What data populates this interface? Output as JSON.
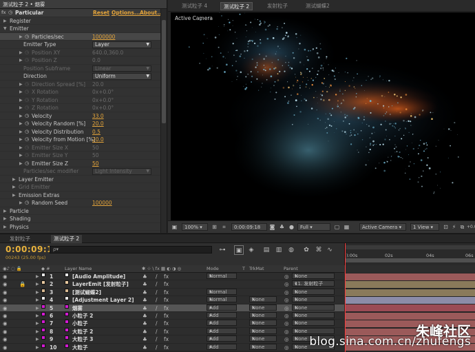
{
  "effect_controls": {
    "tab_title": "测试粒子 2 • 烟雾",
    "effect_name": "Particular",
    "reset_label": "Reset",
    "options_label": "Options...",
    "about_label": "About...",
    "rows": [
      {
        "label": "Register",
        "kind": "group",
        "indent": 1,
        "open": false
      },
      {
        "label": "Emitter",
        "kind": "group",
        "indent": 1,
        "open": true
      },
      {
        "label": "Particles/sec",
        "kind": "value",
        "indent": 2,
        "value": "1000000",
        "selected": true
      },
      {
        "label": "Emitter Type",
        "kind": "dropdown",
        "indent": 2,
        "value": "Layer"
      },
      {
        "label": "Position XY",
        "kind": "value",
        "indent": 2,
        "value": "640.0,360.0",
        "dim": true
      },
      {
        "label": "Position Z",
        "kind": "value",
        "indent": 2,
        "value": "0.0",
        "dim": true
      },
      {
        "label": "Position Subframe",
        "kind": "dropdown",
        "indent": 2,
        "value": "Linear",
        "dim": true
      },
      {
        "label": "Direction",
        "kind": "dropdown",
        "indent": 2,
        "value": "Uniform"
      },
      {
        "label": "Direction Spread [%]",
        "kind": "value",
        "indent": 2,
        "value": "20.0",
        "dim": true
      },
      {
        "label": "X Rotation",
        "kind": "value",
        "indent": 2,
        "value": "0x+0.0°",
        "dim": true
      },
      {
        "label": "Y Rotation",
        "kind": "value",
        "indent": 2,
        "value": "0x+0.0°",
        "dim": true
      },
      {
        "label": "Z Rotation",
        "kind": "value",
        "indent": 2,
        "value": "0x+0.0°",
        "dim": true
      },
      {
        "label": "Velocity",
        "kind": "value",
        "indent": 2,
        "value": "33.0"
      },
      {
        "label": "Velocity Random [%]",
        "kind": "value",
        "indent": 2,
        "value": "20.0"
      },
      {
        "label": "Velocity Distribution",
        "kind": "value",
        "indent": 2,
        "value": "0.5"
      },
      {
        "label": "Velocity from Motion [%]",
        "kind": "value",
        "indent": 2,
        "value": "20.0"
      },
      {
        "label": "Emitter Size X",
        "kind": "value",
        "indent": 2,
        "value": "50",
        "dim": true
      },
      {
        "label": "Emitter Size Y",
        "kind": "value",
        "indent": 2,
        "value": "50",
        "dim": true
      },
      {
        "label": "Emitter Size Z",
        "kind": "value",
        "indent": 2,
        "value": "50"
      },
      {
        "label": "Particles/sec modifier",
        "kind": "dropdown",
        "indent": 2,
        "value": "Light Intensity",
        "dim": true
      },
      {
        "label": "Layer Emitter",
        "kind": "group",
        "indent": 2,
        "open": false
      },
      {
        "label": "Grid Emitter",
        "kind": "group",
        "indent": 2,
        "open": false,
        "dim": true
      },
      {
        "label": "Emission Extras",
        "kind": "group",
        "indent": 2,
        "open": false
      },
      {
        "label": "Random Seed",
        "kind": "value",
        "indent": 2,
        "value": "100000"
      },
      {
        "label": "Particle",
        "kind": "group",
        "indent": 1,
        "open": false
      },
      {
        "label": "Shading",
        "kind": "group",
        "indent": 1,
        "open": false
      },
      {
        "label": "Physics",
        "kind": "group",
        "indent": 1,
        "open": false
      }
    ]
  },
  "composition": {
    "tabs": [
      "测试粒子 4",
      "测试粒子 2",
      "发射粒子",
      "测试蝴蝶2"
    ],
    "active_tab": 1,
    "viewer_label": "Active Camera",
    "toolbar": {
      "zoom": "100%",
      "timecode": "0:00:09:18",
      "resolution": "Full",
      "camera": "Active Camera",
      "view": "1 View",
      "exposure": "+0.0"
    }
  },
  "timeline": {
    "tabs": [
      "发射粒子",
      "测试粒子 2"
    ],
    "active_tab": 1,
    "timecode": "0:00:09:18",
    "frame_info": "00243 (25.00 fps)",
    "search_placeholder": "ρ▾",
    "columns": {
      "layer_name": "Layer Name",
      "mode": "Mode",
      "t": "T",
      "trkmat": "TrkMat",
      "parent": "Parent"
    },
    "ruler_ticks": [
      "):00s",
      "02s",
      "04s",
      "06s"
    ],
    "layers": [
      {
        "num": "1",
        "name": "[Audio Amplitude]",
        "label_color": "#e8e8e8",
        "mode": "Normal",
        "trkmat": "",
        "parent": "None",
        "bar_color": "#9b5a5a"
      },
      {
        "num": "2",
        "name": "LayerEmit [发射粒子]",
        "label_color": "#e8c9a0",
        "mode": "",
        "trkmat": "",
        "parent": "11. 发射粒子",
        "bar_color": "#8a7a5a"
      },
      {
        "num": "3",
        "name": "[测试蝴蝶2]",
        "label_color": "#d8b890",
        "mode": "Normal",
        "trkmat": "",
        "parent": "None",
        "bar_color": "#8a7a5a"
      },
      {
        "num": "4",
        "name": "[Adjustment Layer 2]",
        "label_color": "#e8e8e8",
        "mode": "Normal",
        "trkmat": "None",
        "parent": "None",
        "bar_color": "#8c8ca8"
      },
      {
        "num": "5",
        "name": "烟雾",
        "label_color": "#d21ad2",
        "mode": "Add",
        "trkmat": "None",
        "parent": "None",
        "bar_color": "#9b4b55",
        "selected": true
      },
      {
        "num": "6",
        "name": "小粒子 2",
        "label_color": "#d21ad2",
        "mode": "Add",
        "trkmat": "None",
        "parent": "None",
        "bar_color": "#9b5a5a"
      },
      {
        "num": "7",
        "name": "小粒子",
        "label_color": "#d21ad2",
        "mode": "Add",
        "trkmat": "None",
        "parent": "None",
        "bar_color": "#9b5a5a"
      },
      {
        "num": "8",
        "name": "大粒子 2",
        "label_color": "#d21ad2",
        "mode": "Add",
        "trkmat": "None",
        "parent": "None",
        "bar_color": "#9b5a5a"
      },
      {
        "num": "9",
        "name": "大粒子 3",
        "label_color": "#d21ad2",
        "mode": "Add",
        "trkmat": "None",
        "parent": "None",
        "bar_color": "#9b5a5a"
      },
      {
        "num": "10",
        "name": "大粒子",
        "label_color": "#d21ad2",
        "mode": "Add",
        "trkmat": "None",
        "parent": "None",
        "bar_color": "#9b5a5a"
      }
    ]
  },
  "watermark": {
    "logo": "朱峰社区",
    "url": "blog.sina.com.cn/zhufengs"
  }
}
